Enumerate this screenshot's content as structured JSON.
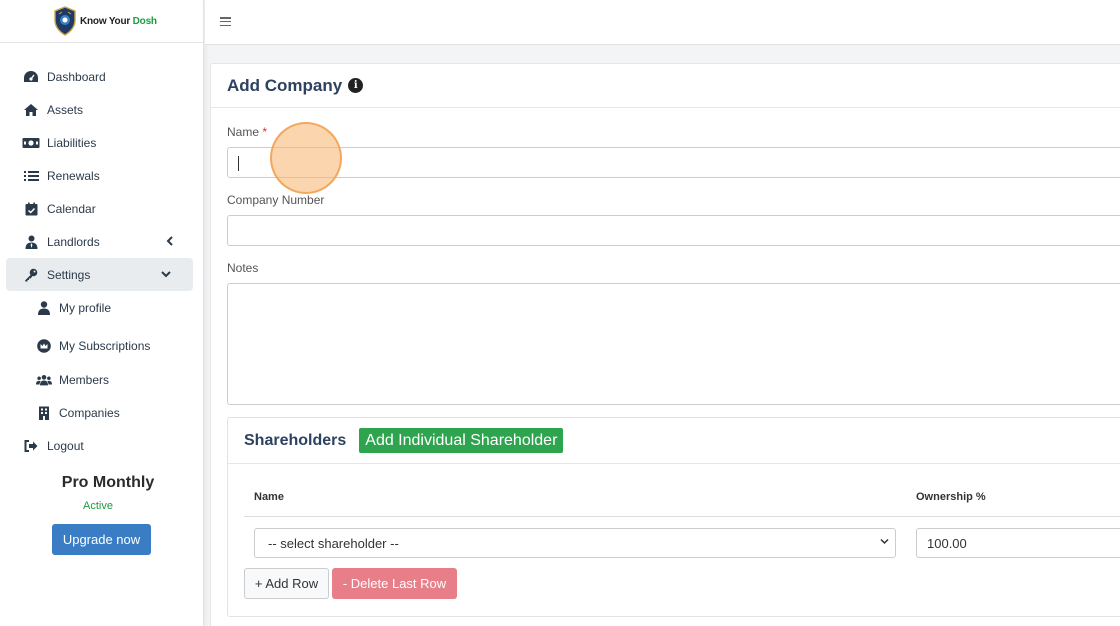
{
  "brand": {
    "name_part1": "Know Your ",
    "name_part2": "Dosh"
  },
  "sidebar": {
    "items": [
      {
        "label": "Dashboard",
        "icon": "dashboard-icon"
      },
      {
        "label": "Assets",
        "icon": "home-icon"
      },
      {
        "label": "Liabilities",
        "icon": "money-icon"
      },
      {
        "label": "Renewals",
        "icon": "list-icon"
      },
      {
        "label": "Calendar",
        "icon": "calendar-check-icon"
      },
      {
        "label": "Landlords",
        "icon": "user-tie-icon"
      },
      {
        "label": "Settings",
        "icon": "key-icon"
      }
    ],
    "settings_sub": [
      {
        "label": "My profile",
        "icon": "user-icon"
      },
      {
        "label": "My Subscriptions",
        "icon": "crown-icon"
      },
      {
        "label": "Members",
        "icon": "users-icon"
      },
      {
        "label": "Companies",
        "icon": "building-icon"
      }
    ],
    "logout": "Logout"
  },
  "plan": {
    "name": "Pro Monthly",
    "status": "Active",
    "upgrade_label": "Upgrade now"
  },
  "form": {
    "title": "Add Company",
    "name_label": "Name",
    "name_required": "*",
    "company_number_label": "Company Number",
    "notes_label": "Notes"
  },
  "shareholders": {
    "title": "Shareholders",
    "add_individual_label": "Add Individual Shareholder",
    "col_name": "Name",
    "col_ownership": "Ownership %",
    "select_value": "-- select shareholder --",
    "ownership_value": "100.00",
    "add_row_label": "+ Add Row",
    "delete_row_label": "- Delete Last Row"
  },
  "colors": {
    "accent_green": "#2ea44f",
    "brand_blue": "#3a7dc4",
    "title_navy": "#2d4260",
    "danger_soft": "#e87f88"
  }
}
